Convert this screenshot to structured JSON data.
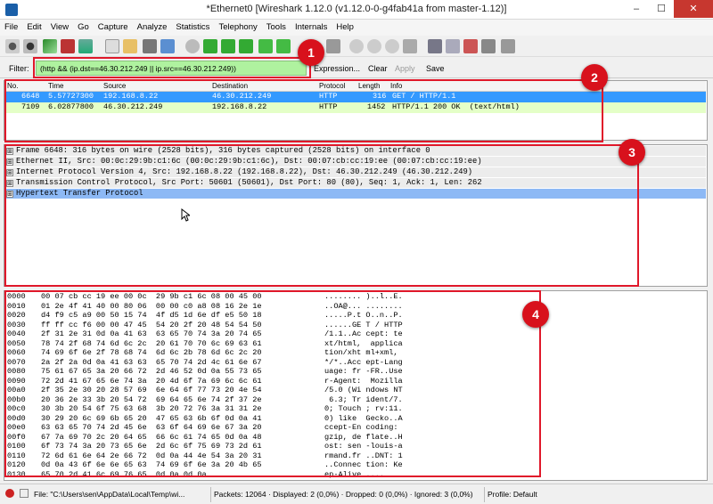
{
  "window": {
    "title": "*Ethernet0   [Wireshark 1.12.0  (v1.12.0-0-g4fab41a from master-1.12)]",
    "min": "–",
    "max": "☐",
    "close": "✕"
  },
  "menu": [
    "File",
    "Edit",
    "View",
    "Go",
    "Capture",
    "Analyze",
    "Statistics",
    "Telephony",
    "Tools",
    "Internals",
    "Help"
  ],
  "filter": {
    "label": "Filter:",
    "value": "(http && (ip.dst==46.30.212.249 || ip.src==46.30.212.249))",
    "expression": "Expression...",
    "clear": "Clear",
    "apply": "Apply",
    "save": "Save"
  },
  "columns": {
    "no": "No.",
    "time": "Time",
    "source": "Source",
    "destination": "Destination",
    "protocol": "Protocol",
    "length": "Length",
    "info": "Info"
  },
  "packets": [
    {
      "no": "6648",
      "time": "5.57727300",
      "source": "192.168.8.22",
      "destination": "46.30.212.249",
      "protocol": "HTTP",
      "length": "316",
      "info": "GET / HTTP/1.1"
    },
    {
      "no": "7109",
      "time": "6.02877800",
      "source": "46.30.212.249",
      "destination": "192.168.8.22",
      "protocol": "HTTP",
      "length": "1452",
      "info": "HTTP/1.1 200 OK  (text/html)"
    }
  ],
  "details": [
    "Frame 6648: 316 bytes on wire (2528 bits), 316 bytes captured (2528 bits) on interface 0",
    "Ethernet II, Src: 00:0c:29:9b:c1:6c (00:0c:29:9b:c1:6c), Dst: 00:07:cb:cc:19:ee (00:07:cb:cc:19:ee)",
    "Internet Protocol Version 4, Src: 192.168.8.22 (192.168.8.22), Dst: 46.30.212.249 (46.30.212.249)",
    "Transmission Control Protocol, Src Port: 50601 (50601), Dst Port: 80 (80), Seq: 1, Ack: 1, Len: 262",
    "Hypertext Transfer Protocol"
  ],
  "expand_glyph": "⊞",
  "hex": [
    [
      "0000",
      "00 07 cb cc 19 ee 00 0c  29 9b c1 6c 08 00 45 00",
      "........ )..l..E."
    ],
    [
      "0010",
      "01 2e 4f 41 40 00 80 06  00 00 c0 a8 08 16 2e 1e",
      "..OA@... ........"
    ],
    [
      "0020",
      "d4 f9 c5 a9 00 50 15 74  4f d5 1d 6e df e5 50 18",
      ".....P.t O..n..P."
    ],
    [
      "0030",
      "ff ff cc f6 00 00 47 45  54 20 2f 20 48 54 54 50",
      "......GE T / HTTP"
    ],
    [
      "0040",
      "2f 31 2e 31 0d 0a 41 63  63 65 70 74 3a 20 74 65",
      "/1.1..Ac cept: te"
    ],
    [
      "0050",
      "78 74 2f 68 74 6d 6c 2c  20 61 70 70 6c 69 63 61",
      "xt/html,  applica"
    ],
    [
      "0060",
      "74 69 6f 6e 2f 78 68 74  6d 6c 2b 78 6d 6c 2c 20",
      "tion/xht ml+xml, "
    ],
    [
      "0070",
      "2a 2f 2a 0d 0a 41 63 63  65 70 74 2d 4c 61 6e 67",
      "*/*..Acc ept-Lang"
    ],
    [
      "0080",
      "75 61 67 65 3a 20 66 72  2d 46 52 0d 0a 55 73 65",
      "uage: fr -FR..Use"
    ],
    [
      "0090",
      "72 2d 41 67 65 6e 74 3a  20 4d 6f 7a 69 6c 6c 61",
      "r-Agent:  Mozilla"
    ],
    [
      "00a0",
      "2f 35 2e 30 20 28 57 69  6e 64 6f 77 73 20 4e 54",
      "/5.0 (Wi ndows NT"
    ],
    [
      "00b0",
      "20 36 2e 33 3b 20 54 72  69 64 65 6e 74 2f 37 2e",
      " 6.3; Tr ident/7."
    ],
    [
      "00c0",
      "30 3b 20 54 6f 75 63 68  3b 20 72 76 3a 31 31 2e",
      "0; Touch ; rv:11."
    ],
    [
      "00d0",
      "30 29 20 6c 69 6b 65 20  47 65 63 6b 6f 0d 0a 41",
      "0) like  Gecko..A"
    ],
    [
      "00e0",
      "63 63 65 70 74 2d 45 6e  63 6f 64 69 6e 67 3a 20",
      "ccept-En coding: "
    ],
    [
      "00f0",
      "67 7a 69 70 2c 20 64 65  66 6c 61 74 65 0d 0a 48",
      "gzip, de flate..H"
    ],
    [
      "0100",
      "6f 73 74 3a 20 73 65 6e  2d 6c 6f 75 69 73 2d 61",
      "ost: sen -louis-a"
    ],
    [
      "0110",
      "72 6d 61 6e 64 2e 66 72  0d 0a 44 4e 54 3a 20 31",
      "rmand.fr ..DNT: 1"
    ],
    [
      "0120",
      "0d 0a 43 6f 6e 6e 65 63  74 69 6f 6e 3a 20 4b 65",
      "..Connec tion: Ke"
    ],
    [
      "0130",
      "65 70 2d 41 6c 69 76 65  0d 0a 0d 0a",
      "ep-Alive ...."
    ]
  ],
  "status": {
    "file": "File: \"C:\\Users\\sen\\AppData\\Local\\Temp\\wi...",
    "packets": "Packets: 12064 · Displayed: 2 (0,0%) · Dropped: 0 (0,0%) · Ignored: 3 (0,0%)",
    "profile": "Profile: Default"
  },
  "markers": [
    "1",
    "2",
    "3",
    "4"
  ],
  "colors": {
    "selected": "#3399ff",
    "row2": "#e4ffc7",
    "highlight": "#8db9f5",
    "filter": "#aff29f",
    "marker": "#d8111c"
  }
}
